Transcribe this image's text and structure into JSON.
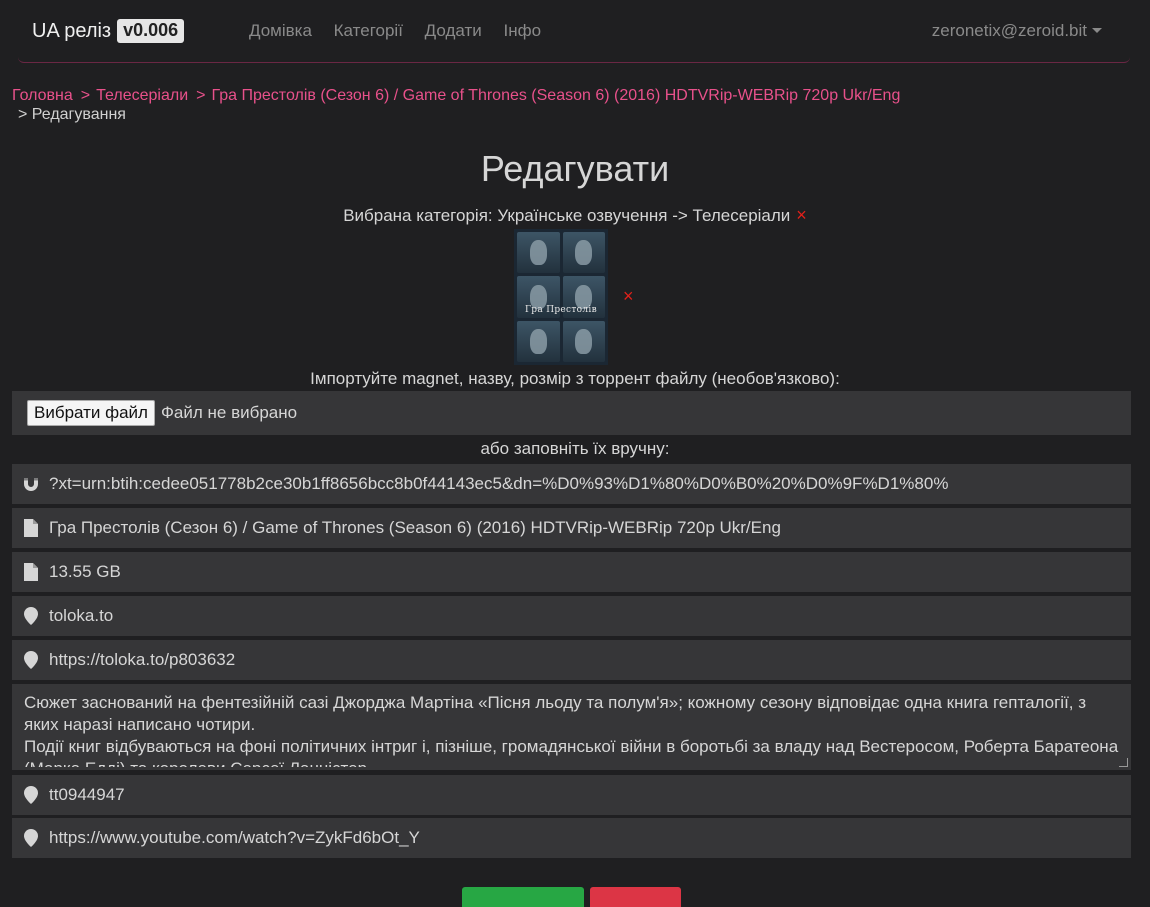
{
  "nav": {
    "brand": "UA реліз",
    "version": "v0.006",
    "links": [
      "Домівка",
      "Категорії",
      "Додати",
      "Інфо"
    ],
    "user": "zeronetix@zeroid.bit"
  },
  "breadcrumb": {
    "items": [
      "Головна",
      "Телесеріали",
      "Гра Престолів (Сезон 6) / Game of Thrones (Season 6) (2016) HDTVRip-WEBRip 720p Ukr/Eng"
    ],
    "current": "Редагування",
    "separator": ">"
  },
  "title": "Редагувати",
  "category": {
    "text": "Вибрана категорія: Українське озвучення -> Телесеріали",
    "remove": "×"
  },
  "poster": {
    "caption": "Гра Престолів",
    "remove": "×"
  },
  "import": {
    "label": "Імпортуйте magnet, назву, розмір з торрент файлу (необов'язково):",
    "button": "Вибрати файл",
    "status": "Файл не вибрано"
  },
  "manual_label": "або заповніть їх вручну:",
  "fields": {
    "magnet": "?xt=urn:btih:cedee051778b2ce30b1ff8656bcc8b0f44143ec5&dn=%D0%93%D1%80%D0%B0%20%D0%9F%D1%80%",
    "name": "Гра Престолів (Сезон 6) / Game of Thrones (Season 6) (2016) HDTVRip-WEBRip 720p Ukr/Eng",
    "size": "13.55 GB",
    "source": "toloka.to",
    "url": "https://toloka.to/p803632",
    "description": "Сюжет заснований на фентезійній сазі Джорджа Мартіна «Пісня льоду та полум'я»; кожному сезону відповідає одна книга гепталогії, з яких наразі написано чотири.\nПодії книг відбуваються на фоні політичних інтриг і, пізніше, громадянської війни в боротьбі за владу над Вестеросом, Роберта Баратеона (Марка Едді) та королеви Серсеї Ланністер",
    "imdb": "tt0944947",
    "trailer": "https://www.youtube.com/watch?v=ZykFd6bOt_Y"
  },
  "colors": {
    "background": "#1f1f21",
    "field_bg": "#363638",
    "link": "#e8518b",
    "remove": "#e0201a",
    "save": "#27a744",
    "cancel": "#dc3545"
  },
  "icons": {
    "magnet": "magnet-icon",
    "name": "file-icon",
    "size": "file-icon",
    "source": "map-marker-icon",
    "url": "map-marker-icon",
    "imdb": "map-marker-icon",
    "trailer": "map-marker-icon"
  }
}
